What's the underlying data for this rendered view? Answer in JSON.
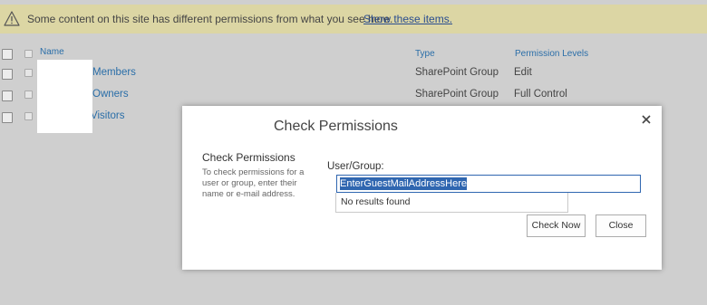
{
  "banner": {
    "icon": "warning-icon",
    "message": "Some content on this site has different permissions from what you see here.",
    "link_label": "Show these items."
  },
  "table": {
    "headers": {
      "name": "Name",
      "type": "Type",
      "permission": "Permission Levels"
    },
    "rows": [
      {
        "name": "Members",
        "type": "SharePoint Group",
        "permission": "Edit"
      },
      {
        "name": "Owners",
        "type": "SharePoint Group",
        "permission": "Full Control"
      },
      {
        "name": "Visitors",
        "type": "",
        "permission": ""
      }
    ]
  },
  "dialog": {
    "title": "Check Permissions",
    "section_title": "Check Permissions",
    "help_text": "To check permissions for a user or group, enter their name or e-mail address.",
    "field_label": "User/Group:",
    "input_value": "EnterGuestMailAddressHere",
    "dropdown_text": "No results found",
    "check_now_label": "Check Now",
    "close_label": "Close",
    "close_icon": "close-icon"
  },
  "colors": {
    "banner_bg": "#dcd6a4",
    "link": "#2a6ea8",
    "selection": "#2f66b0"
  }
}
